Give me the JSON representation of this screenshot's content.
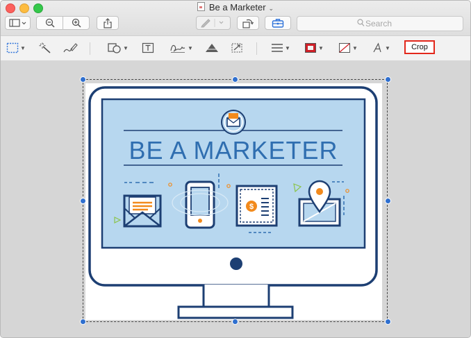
{
  "window": {
    "title": "Be a Marketer"
  },
  "toolbar": {
    "search_placeholder": "Search",
    "crop_label": "Crop"
  },
  "image": {
    "headline": "BE A MARKETER",
    "dollar_glyph": "$"
  },
  "colors": {
    "close": "#fc615d",
    "minimize": "#fdbc40",
    "zoom": "#34c84a",
    "selection_handle": "#2f6fcf",
    "crop_highlight": "#e2271b",
    "illustration_navy": "#1d3f73",
    "illustration_screen": "#b7d7ef",
    "illustration_accent": "#f28a1c"
  }
}
